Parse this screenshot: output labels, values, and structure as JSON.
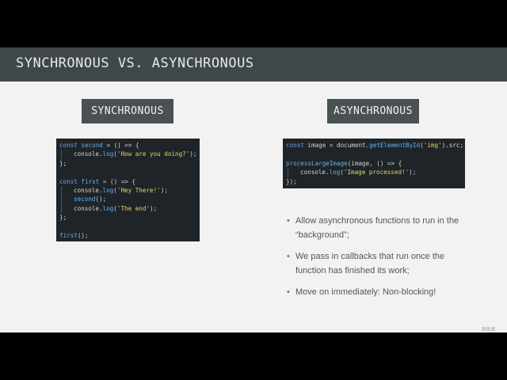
{
  "slide": {
    "title": "SYNCHRONOUS VS. ASYNCHRONOUS",
    "sync_label": "SYNCHRONOUS",
    "async_label": "ASYNCHRONOUS"
  },
  "sync_code": {
    "l1_kw": "const",
    "l1_name": " second",
    "l1_rest": " = () => {",
    "l2_obj": "console.",
    "l2_fn": "log",
    "l2_p1": "(",
    "l2_str": "'How are you doing?'",
    "l2_p2": ");",
    "l3": "};",
    "l4_kw": "const",
    "l4_name": " first",
    "l4_rest": " = () => {",
    "l5_obj": "console.",
    "l5_fn": "log",
    "l5_p1": "(",
    "l5_str": "'Hey There!'",
    "l5_p2": ");",
    "l6_fn": "second",
    "l6_rest": "();",
    "l7_obj": "console.",
    "l7_fn": "log",
    "l7_p1": "(",
    "l7_str": "'The end'",
    "l7_p2": ");",
    "l8": "};",
    "l9_fn": "first",
    "l9_rest": "();"
  },
  "async_code": {
    "l1_kw": "const",
    "l1_a": " image = ",
    "l1_obj": "document.",
    "l1_fn": "getElementById",
    "l1_p1": "(",
    "l1_str": "'img'",
    "l1_p2": ").src;",
    "l2_fn": "processLargeImage",
    "l2_rest": "(image, () => {",
    "l3_obj": "console.",
    "l3_fn": "log",
    "l3_p1": "(",
    "l3_str": "'Image processed!'",
    "l3_p2": ");",
    "l4": "});"
  },
  "bullets": [
    "Allow asynchronous functions to run in the “background”;",
    "We pass in callbacks that run once the function has finished its work;",
    "Move on immediately: Non-blocking!"
  ],
  "bullet_symbol": "•"
}
